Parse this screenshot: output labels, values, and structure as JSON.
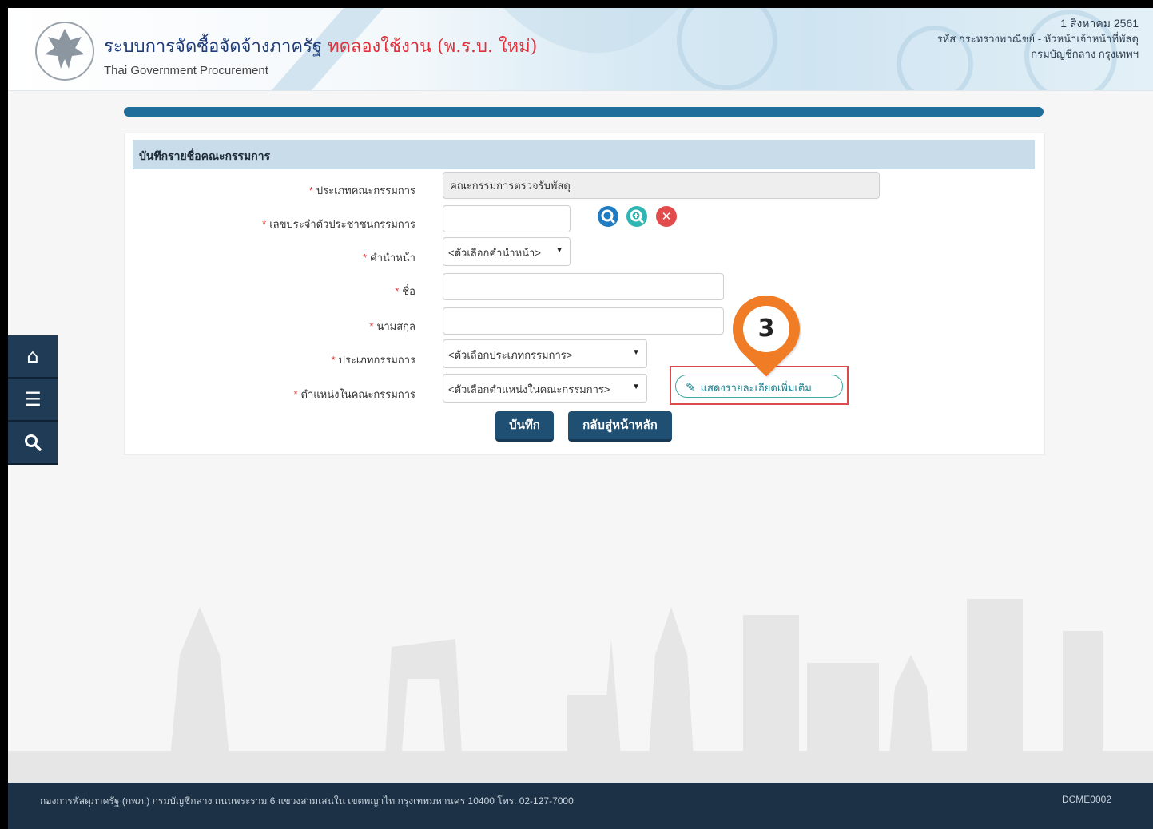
{
  "header": {
    "title_main": "ระบบการจัดซื้อจัดจ้างภาครัฐ",
    "title_trial": "ทดลองใช้งาน (พ.ร.บ. ใหม่)",
    "subtitle": "Thai Government Procurement",
    "date": "1 สิงหาคม 2561",
    "user_line1": "รหัส กระทรวงพาณิชย์ - หัวหน้าเจ้าหน้าที่พัสดุ",
    "user_line2": "กรมบัญชีกลาง กรุงเทพฯ"
  },
  "panel": {
    "title": "บันทึกรายชื่อคณะกรรมการ",
    "required_mark": "*",
    "fields": {
      "committee_type_label": "ประเภทคณะกรรมการ",
      "committee_type_value": "คณะกรรมการตรวจรับพัสดุ",
      "citizen_id_label": "เลขประจำตัวประชาชนกรรมการ",
      "citizen_id_value": "",
      "prefix_label": "คำนำหน้า",
      "prefix_value": "<ตัวเลือกคำนำหน้า>",
      "firstname_label": "ชื่อ",
      "firstname_value": "",
      "lastname_label": "นามสกุล",
      "lastname_value": "",
      "member_type_label": "ประเภทกรรมการ",
      "member_type_value": "<ตัวเลือกประเภทกรรมการ>",
      "position_label": "ตำแหน่งในคณะกรรมการ",
      "position_value": "<ตัวเลือกตำแหน่งในคณะกรรมการ>"
    },
    "more_details_label": "แสดงรายละเอียดเพิ่มเติม",
    "save_label": "บันทึก",
    "back_label": "กลับสู่หน้าหลัก",
    "step_marker": "3"
  },
  "icons": {
    "search": "search-icon",
    "zoom_in": "zoom-in-icon",
    "clear": "clear-icon",
    "home": "home-icon",
    "menu": "menu-icon",
    "sidebar_search": "search-icon",
    "edit": "edit-icon"
  },
  "colors": {
    "accent": "#1f6d9a",
    "button": "#1f4f73",
    "marker": "#f07d26",
    "highlight_border": "#dc4b4b",
    "footer": "#1c3145"
  },
  "footer": {
    "address": "กองการพัสดุภาครัฐ (กพภ.) กรมบัญชีกลาง ถนนพระราม 6 แขวงสามเสนใน เขตพญาไท กรุงเทพมหานคร 10400 โทร. 02-127-7000",
    "page_code": "DCME0002"
  }
}
